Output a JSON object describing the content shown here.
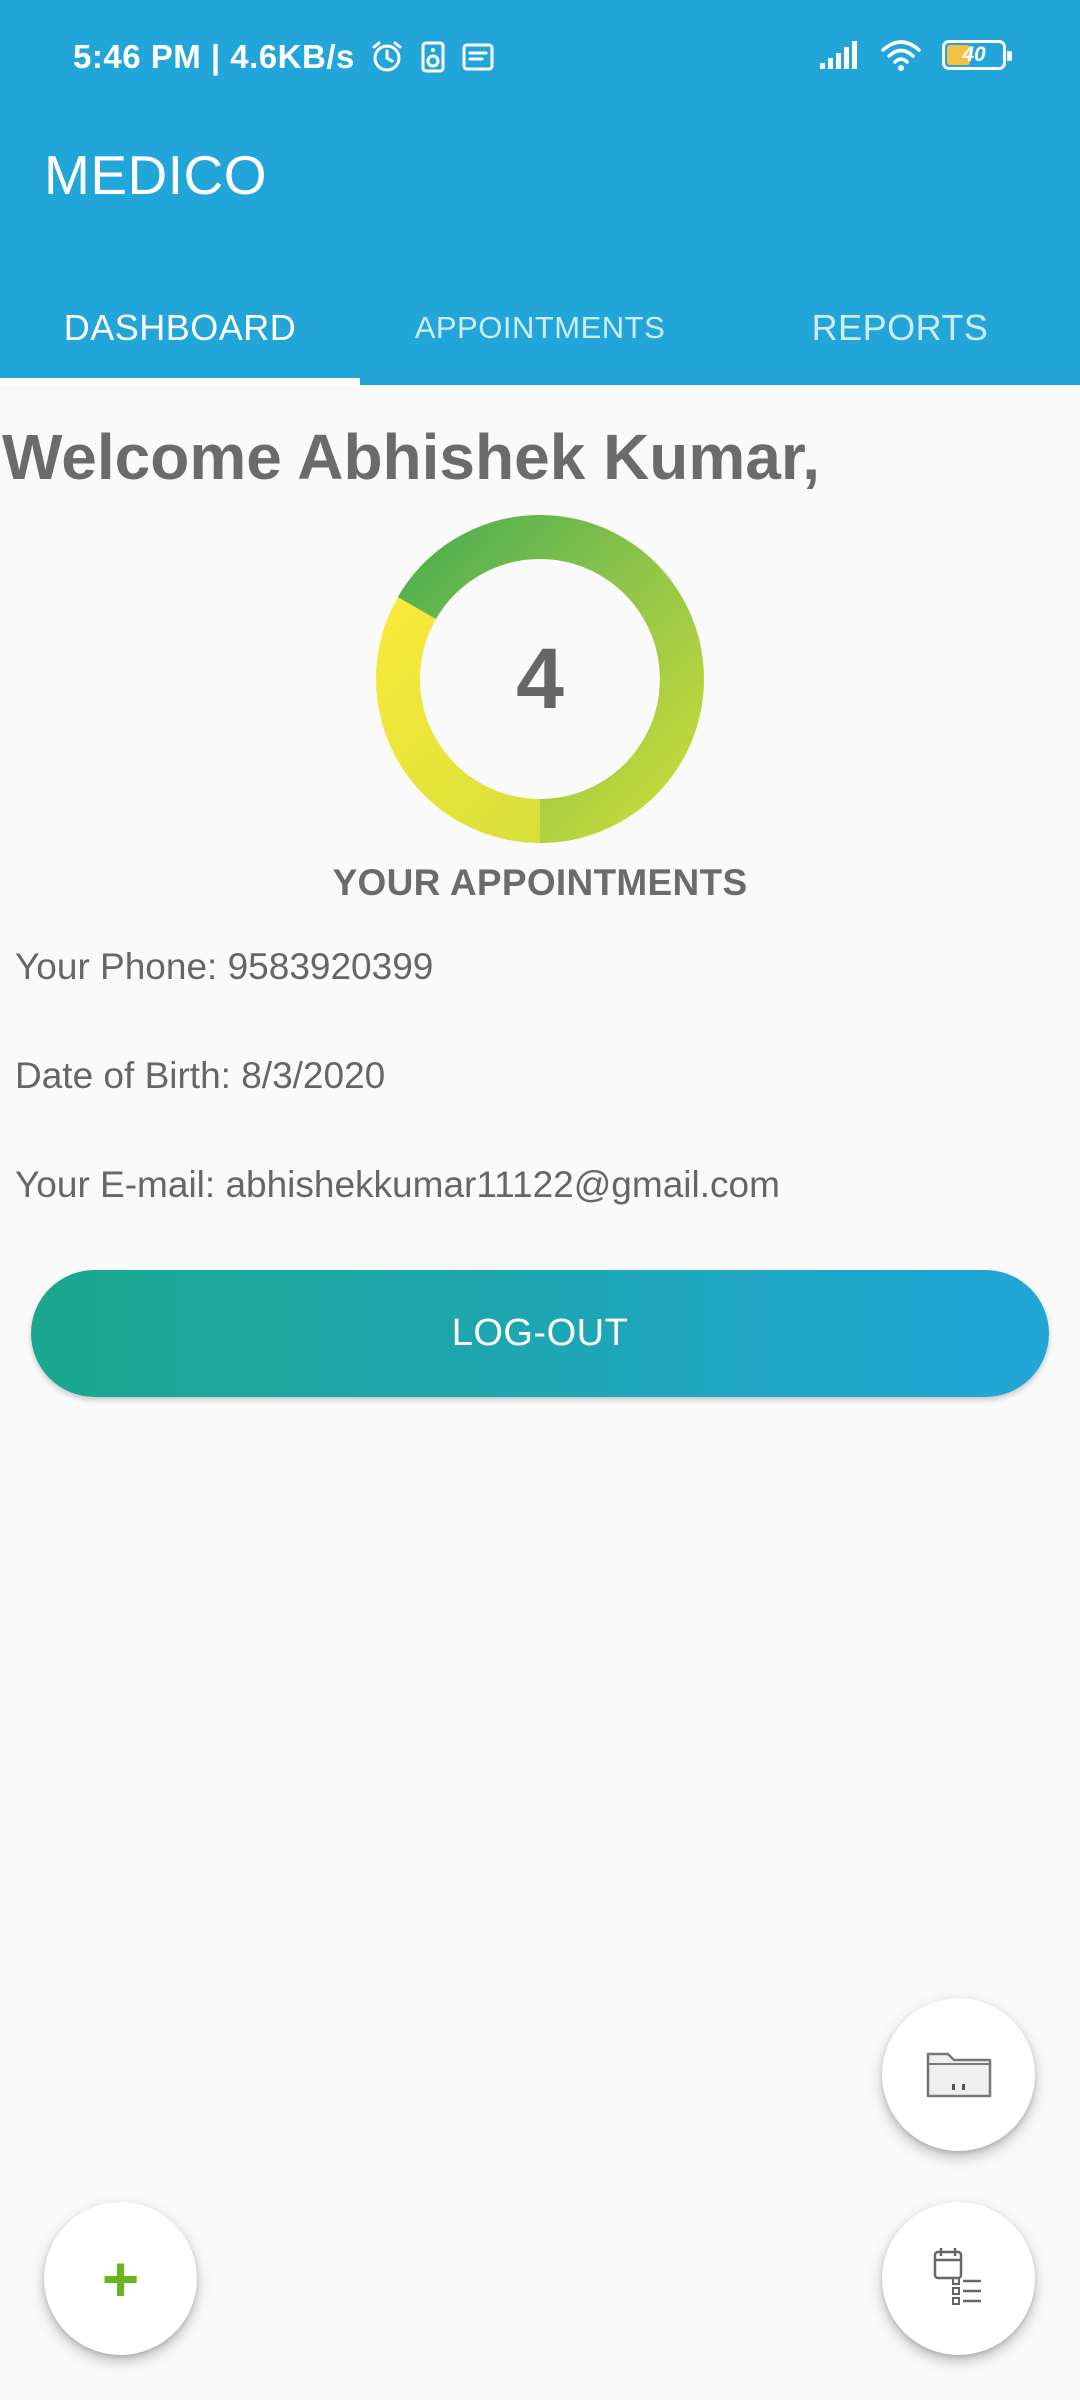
{
  "status_bar": {
    "time": "5:46 PM | 4.6KB/s",
    "battery_level": "40",
    "icons": [
      "alarm-icon",
      "speaker-icon",
      "notes-icon",
      "signal-icon",
      "wifi-icon",
      "battery-icon"
    ]
  },
  "app_bar": {
    "title": "MEDICO",
    "background_color": "#22a6d9"
  },
  "tabs": [
    {
      "label": "DASHBOARD",
      "active": true
    },
    {
      "label": "APPOINTMENTS",
      "active": false
    },
    {
      "label": "REPORTS",
      "active": false
    }
  ],
  "dashboard": {
    "welcome": "Welcome Abhishek Kumar,",
    "appointments_count": "4",
    "appointments_label": "YOUR APPOINTMENTS",
    "phone": "Your Phone: 9583920399",
    "dob": "Date of Birth: 8/3/2020",
    "email": "Your E-mail: abhishekkumar11122@gmail.com",
    "logout_label": "LOG-OUT",
    "gradient_colors": [
      "#1aa78e",
      "#22a6d9"
    ]
  },
  "fabs": {
    "add_label": "+",
    "add_color": "#6ab520",
    "folder_icon": "folder-icon",
    "list_icon": "appointment-list-icon"
  }
}
